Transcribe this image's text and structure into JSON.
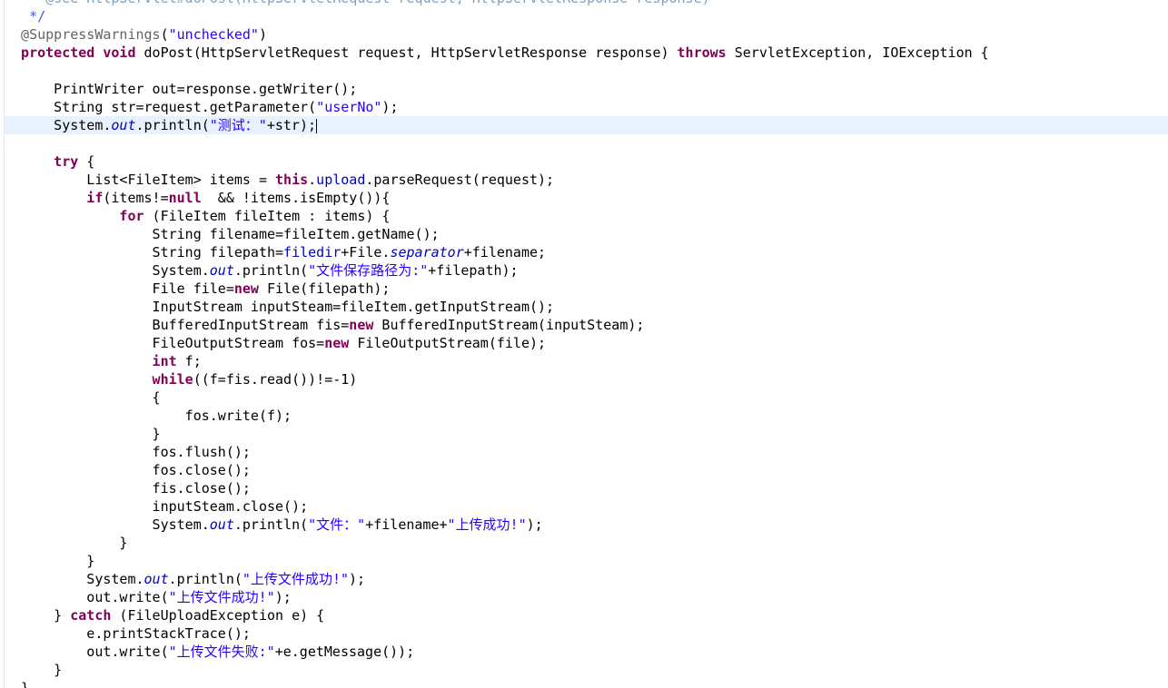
{
  "editor": {
    "language": "java",
    "current_line_index": 5,
    "colors": {
      "background": "#ffffff",
      "current_line": "#e8f2fe",
      "keyword": "#7f0055",
      "string": "#2a00ff",
      "field": "#0000c0",
      "annotation": "#646464",
      "comment": "#3f5fbf",
      "plain": "#000000"
    },
    "lines": [
      [
        [
          "cmt-faded",
          "   * @see HttpServlet#doPost(HttpServletRequest request, HttpServletResponse response)"
        ]
      ],
      [
        [
          "cmt",
          "   */"
        ]
      ],
      [
        [
          "ann",
          "  @SuppressWarnings"
        ],
        [
          "",
          "("
        ],
        [
          "str",
          "\"unchecked\""
        ],
        [
          "",
          ")"
        ]
      ],
      [
        [
          "kw",
          "  protected"
        ],
        [
          "",
          " "
        ],
        [
          "kw",
          "void"
        ],
        [
          "",
          " doPost(HttpServletRequest request, HttpServletResponse response) "
        ],
        [
          "kw",
          "throws"
        ],
        [
          "",
          " ServletException, IOException {"
        ]
      ],
      [
        [
          "",
          ""
        ]
      ],
      [
        [
          "",
          "      PrintWriter out=response.getWriter();"
        ]
      ],
      [
        [
          "",
          "      String str=request.getParameter("
        ],
        [
          "str",
          "\"userNo\""
        ],
        [
          "",
          ");"
        ]
      ],
      [
        [
          "",
          "      System."
        ],
        [
          "sfld",
          "out"
        ],
        [
          "",
          ".println("
        ],
        [
          "str",
          "\"测试：\""
        ],
        [
          "",
          "+str);"
        ]
      ],
      [
        [
          "",
          ""
        ]
      ],
      [
        [
          "kw",
          "      try"
        ],
        [
          "",
          " {"
        ]
      ],
      [
        [
          "",
          "          List<FileItem> items = "
        ],
        [
          "kw",
          "this"
        ],
        [
          "",
          "."
        ],
        [
          "fld",
          "upload"
        ],
        [
          "",
          ".parseRequest(request);"
        ]
      ],
      [
        [
          "kw",
          "          if"
        ],
        [
          "",
          "(items!="
        ],
        [
          "kw",
          "null"
        ],
        [
          "",
          "  && !items.isEmpty()){"
        ]
      ],
      [
        [
          "kw",
          "              for"
        ],
        [
          "",
          " (FileItem fileItem : items) {"
        ]
      ],
      [
        [
          "",
          "                  String filename=fileItem.getName();"
        ]
      ],
      [
        [
          "",
          "                  String filepath="
        ],
        [
          "fld",
          "filedir"
        ],
        [
          "",
          "+File."
        ],
        [
          "sfld",
          "separator"
        ],
        [
          "",
          "+filename;"
        ]
      ],
      [
        [
          "",
          "                  System."
        ],
        [
          "sfld",
          "out"
        ],
        [
          "",
          ".println("
        ],
        [
          "str",
          "\"文件保存路径为:\""
        ],
        [
          "",
          "+filepath);"
        ]
      ],
      [
        [
          "",
          "                  File file="
        ],
        [
          "kw",
          "new"
        ],
        [
          "",
          " File(filepath);"
        ]
      ],
      [
        [
          "",
          "                  InputStream inputSteam=fileItem.getInputStream();"
        ]
      ],
      [
        [
          "",
          "                  BufferedInputStream fis="
        ],
        [
          "kw",
          "new"
        ],
        [
          "",
          " BufferedInputStream(inputSteam);"
        ]
      ],
      [
        [
          "",
          "                  FileOutputStream fos="
        ],
        [
          "kw",
          "new"
        ],
        [
          "",
          " FileOutputStream(file);"
        ]
      ],
      [
        [
          "kw",
          "                  int"
        ],
        [
          "",
          " f;"
        ]
      ],
      [
        [
          "kw",
          "                  while"
        ],
        [
          "",
          "((f=fis.read())!=-1)"
        ]
      ],
      [
        [
          "",
          "                  {"
        ]
      ],
      [
        [
          "",
          "                      fos.write(f);"
        ]
      ],
      [
        [
          "",
          "                  }"
        ]
      ],
      [
        [
          "",
          "                  fos.flush();"
        ]
      ],
      [
        [
          "",
          "                  fos.close();"
        ]
      ],
      [
        [
          "",
          "                  fis.close();"
        ]
      ],
      [
        [
          "",
          "                  inputSteam.close();"
        ]
      ],
      [
        [
          "",
          "                  System."
        ],
        [
          "sfld",
          "out"
        ],
        [
          "",
          ".println("
        ],
        [
          "str",
          "\"文件：\""
        ],
        [
          "",
          "+filename+"
        ],
        [
          "str",
          "\"上传成功!\""
        ],
        [
          "",
          ");"
        ]
      ],
      [
        [
          "",
          "              }"
        ]
      ],
      [
        [
          "",
          "          }"
        ]
      ],
      [
        [
          "",
          "          System."
        ],
        [
          "sfld",
          "out"
        ],
        [
          "",
          ".println("
        ],
        [
          "str",
          "\"上传文件成功!\""
        ],
        [
          "",
          ");"
        ]
      ],
      [
        [
          "",
          "          out.write("
        ],
        [
          "str",
          "\"上传文件成功!\""
        ],
        [
          "",
          ");"
        ]
      ],
      [
        [
          "",
          "      } "
        ],
        [
          "kw",
          "catch"
        ],
        [
          "",
          " (FileUploadException e) {"
        ]
      ],
      [
        [
          "",
          "          e.printStackTrace();"
        ]
      ],
      [
        [
          "",
          "          out.write("
        ],
        [
          "str",
          "\"上传文件失败:\""
        ],
        [
          "",
          "+e.getMessage());"
        ]
      ],
      [
        [
          "",
          "      }"
        ]
      ],
      [
        [
          "",
          "  }"
        ]
      ]
    ]
  }
}
